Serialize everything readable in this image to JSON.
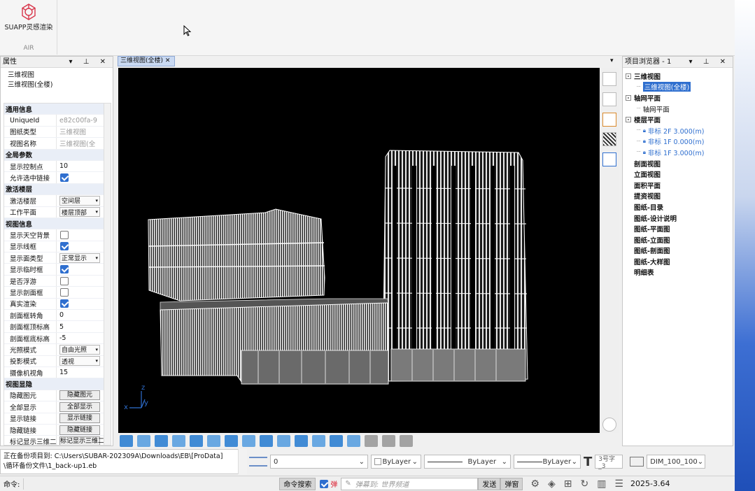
{
  "ribbon": {
    "logo_text": "SUAPP灵感渲染",
    "group_label": "AIR"
  },
  "properties": {
    "title": "属性",
    "selection": [
      "三维视图",
      "三维视图(全楼)"
    ],
    "rows": [
      {
        "type": "cat",
        "k": "通用信息"
      },
      {
        "k": "UniqueId",
        "v": "e82c00fa-9",
        "gray": true
      },
      {
        "k": "图纸类型",
        "v": "三维视图",
        "gray": true
      },
      {
        "k": "视图名称",
        "v": "三维视图(全",
        "gray": true
      },
      {
        "type": "cat",
        "k": "全局参数"
      },
      {
        "k": "显示控制点",
        "v": "10"
      },
      {
        "k": "允许选中链接",
        "check": true
      },
      {
        "type": "cat",
        "k": "激活楼层"
      },
      {
        "k": "激活楼层",
        "dd": "空间层"
      },
      {
        "k": "工作平面",
        "dd": "楼层顶部"
      },
      {
        "type": "cat",
        "k": "视图信息"
      },
      {
        "k": "显示天空背景",
        "check": false
      },
      {
        "k": "显示线框",
        "check": true
      },
      {
        "k": "显示面类型",
        "dd": "正常显示"
      },
      {
        "k": "显示临时框",
        "check": true
      },
      {
        "k": "是否浮游",
        "check": false
      },
      {
        "k": "显示剖面框",
        "check": false
      },
      {
        "k": "真实渲染",
        "check": true
      },
      {
        "k": "剖面框转角",
        "v": "0"
      },
      {
        "k": "剖面框顶标高",
        "v": "5"
      },
      {
        "k": "剖面框底标高",
        "v": "-5"
      },
      {
        "k": "光照模式",
        "dd": "自由光照"
      },
      {
        "k": "投影模式",
        "dd": "透视"
      },
      {
        "k": "摄像机视角",
        "v": "15"
      },
      {
        "type": "cat",
        "k": "视图显隐"
      },
      {
        "k": "隐藏图元",
        "btn": "隐藏图元"
      },
      {
        "k": "全部显示",
        "btn": "全部显示"
      },
      {
        "k": "显示链接",
        "btn": "显示链接"
      },
      {
        "k": "隐藏链接",
        "btn": "隐藏链接"
      },
      {
        "k": "标记显示三维二",
        "btn": "标记显示三维二"
      }
    ]
  },
  "viewport": {
    "tab_label": "三维视图(全楼)",
    "axis": {
      "x": "x",
      "y": "y",
      "z": "z"
    }
  },
  "browser": {
    "title": "项目浏览器 - 1",
    "items": [
      {
        "level": 0,
        "label": "三维视图",
        "box": "-"
      },
      {
        "level": 1,
        "label": "三维视图(全楼)",
        "selected": true
      },
      {
        "level": 0,
        "label": "轴网平面",
        "box": "-"
      },
      {
        "level": 1,
        "label": "轴网平面"
      },
      {
        "level": 0,
        "label": "楼层平面",
        "box": "-"
      },
      {
        "level": 1,
        "label": "非标 2F 3.000(m)",
        "lock": true
      },
      {
        "level": 1,
        "label": "非标 1F 0.000(m)",
        "lock": true
      },
      {
        "level": 1,
        "label": "非标  1F  3.000(m)",
        "lock": true
      },
      {
        "level": 0,
        "label": "剖面视图"
      },
      {
        "level": 0,
        "label": "立面视图"
      },
      {
        "level": 0,
        "label": "面积平面"
      },
      {
        "level": 0,
        "label": "提资视图"
      },
      {
        "level": 0,
        "label": "图纸-目录"
      },
      {
        "level": 0,
        "label": "图纸-设计说明"
      },
      {
        "level": 0,
        "label": "图纸-平面图"
      },
      {
        "level": 0,
        "label": "图纸-立面图"
      },
      {
        "level": 0,
        "label": "图纸-剖面图"
      },
      {
        "level": 0,
        "label": "图纸-大样图"
      },
      {
        "level": 0,
        "label": "明细表"
      }
    ]
  },
  "output": {
    "line1": "正在备份项目到:  C:\\Users\\SUBAR-202309A\\Downloads\\EB\\[ProData]",
    "line2": "\\循环备份文件\\1_back-up1.eb"
  },
  "layer_strip": {
    "layer": "0",
    "color": "ByLayer",
    "linetype": "ByLayer",
    "lineweight": "ByLayer",
    "text_style": "3号字_3",
    "dim_style": "DIM_100_100"
  },
  "status": {
    "command_label": "命令:",
    "search_button": "命令搜索",
    "danmaku_toggle": "弹",
    "danmaku_placeholder": "弹幕到: 世界频道",
    "send_button": "发送",
    "danmaku_window": "弹窗",
    "version": "2025-3.64"
  },
  "colors": {
    "accent": "#2f6fcf",
    "viewport_bg": "#000000"
  }
}
